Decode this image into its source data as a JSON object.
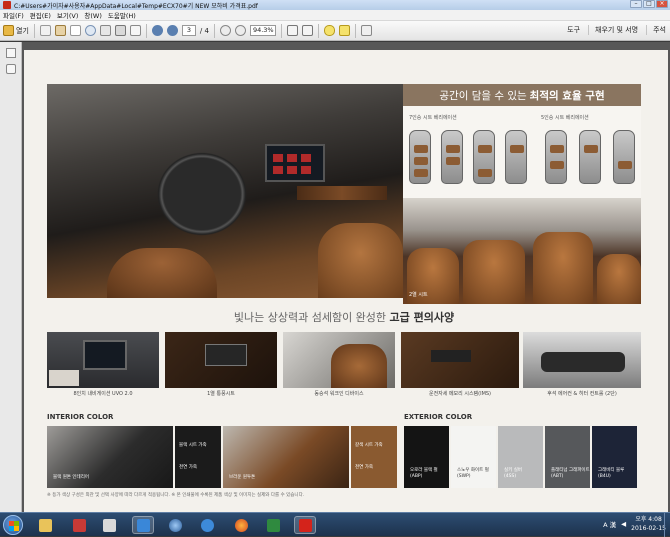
{
  "window": {
    "title": "C:#Users#가이자#사용자#AppData#Local#Temp#ECX70#기 NEW 모하비 가격표.pdf"
  },
  "menu": [
    "파일(F)",
    "편집(E)",
    "보기(V)",
    "창(W)",
    "도움말(H)"
  ],
  "toolbar": {
    "open_label": "열기",
    "page_current": "3",
    "page_total": "/ 4",
    "zoom": "94.3%",
    "tools_label": "도구",
    "fill_sign_label": "채우기 및 서명",
    "comment_label": "주석"
  },
  "brochure": {
    "headline_light": "공간이 담을 수 있는",
    "headline_bold": "최적의 효율 구현",
    "seat7_label": "7인승 시트 베리에이션",
    "seat5_label": "5인승 시트 베리에이션",
    "rear_caption": "2열 시트",
    "subhead_light": "빛나는 상상력과 섬세함이 완성한",
    "subhead_bold": "고급 편의사양",
    "thumbs": [
      "8인치 내비게이션 UVO 2.0",
      "1열 통풍시트",
      "동승석 워크인 디바이스",
      "운전자세 메모리 시스템(IMS)",
      "후석 에어컨 & 히터 컨트롤 (2단)"
    ],
    "interior_title": "INTERIOR COLOR",
    "exterior_title": "EXTERIOR COLOR",
    "interior_panels": [
      {
        "label": "블랙 원톤 인테리어"
      },
      {
        "label": "블랙 시트 가죽",
        "sub": "천연 가죽"
      },
      {
        "label": "브라운 원투톤"
      },
      {
        "label": "갈색 시트 가죽",
        "sub": "천연 가죽"
      }
    ],
    "exterior_swatches": [
      {
        "name": "오로라 블랙 펄",
        "code": "(ABP)",
        "color": "#141414",
        "text": "#ffffff"
      },
      {
        "name": "스노우 화이트 펄",
        "code": "(SWP)",
        "color": "#f4f4f2",
        "text": "#333333"
      },
      {
        "name": "실키 실버",
        "code": "(4SS)",
        "color": "#b9babb",
        "text": "#ffffff"
      },
      {
        "name": "플래티넘 그래파이트",
        "code": "(ABT)",
        "color": "#56585b",
        "text": "#ffffff"
      },
      {
        "name": "그래비티 블루",
        "code": "(B4U)",
        "color": "#1d2437",
        "text": "#ffffff"
      }
    ],
    "footnote": "※ 등가 색상 구성은 외관 및 선택 사양에 따라 다르게 적용됩니다.   ※ 본 인쇄물에 수록된 제품 색상 및 이미지는 실제와 다를 수 있습니다."
  },
  "taskbar": {
    "tray_text": "A 漢",
    "clock_time": "오후 4:08",
    "clock_date": "2016-02-15"
  },
  "colors": {
    "brochure_bg": "#f3f1ec",
    "headline_bg": "#8a7560",
    "taskbar": "#1d324d"
  }
}
